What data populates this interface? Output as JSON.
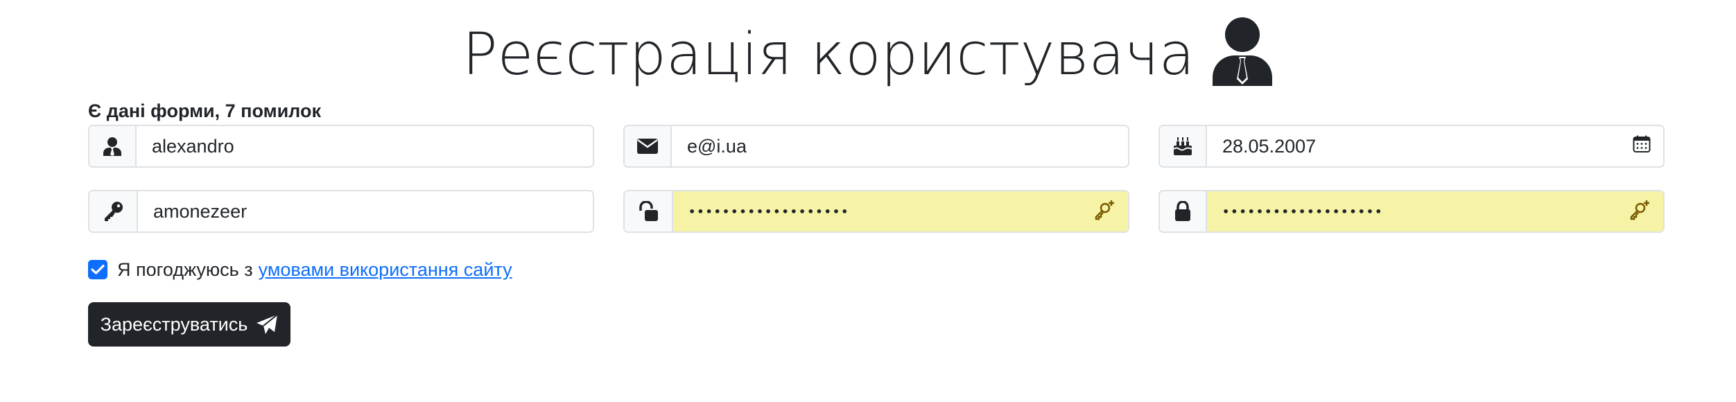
{
  "header": {
    "title": "Реєстрація користувача",
    "icon": "user-tie-icon"
  },
  "form": {
    "status_text": "Є дані форми, 7 помилок",
    "fields": {
      "login": {
        "value": "alexandro",
        "icon": "user-icon"
      },
      "email": {
        "value": "e@i.ua",
        "icon": "envelope-icon"
      },
      "birthdate": {
        "value": "28.05.2007",
        "icon": "birthday-cake-icon",
        "trailing_icon": "calendar-icon"
      },
      "name": {
        "value": "amonezeer",
        "icon": "key-icon"
      },
      "password": {
        "value": "•••••••••••••••••••",
        "icon": "unlock-icon",
        "trailing_icon": "key-plus-icon"
      },
      "password_repeat": {
        "value": "•••••••••••••••••••",
        "icon": "lock-icon",
        "trailing_icon": "key-plus-icon"
      }
    },
    "agree": {
      "checked": true,
      "label": "Я погоджуюсь з",
      "link_text": "умовами використання сайту"
    },
    "submit": {
      "label": "Зареєструватись",
      "icon": "send-icon"
    }
  },
  "colors": {
    "text": "#212529",
    "border": "#dee2e6",
    "addon_bg": "#f8f9fa",
    "autofill_bg": "#f6f3a6",
    "accent": "#0d6efd",
    "button_bg": "#212529"
  }
}
